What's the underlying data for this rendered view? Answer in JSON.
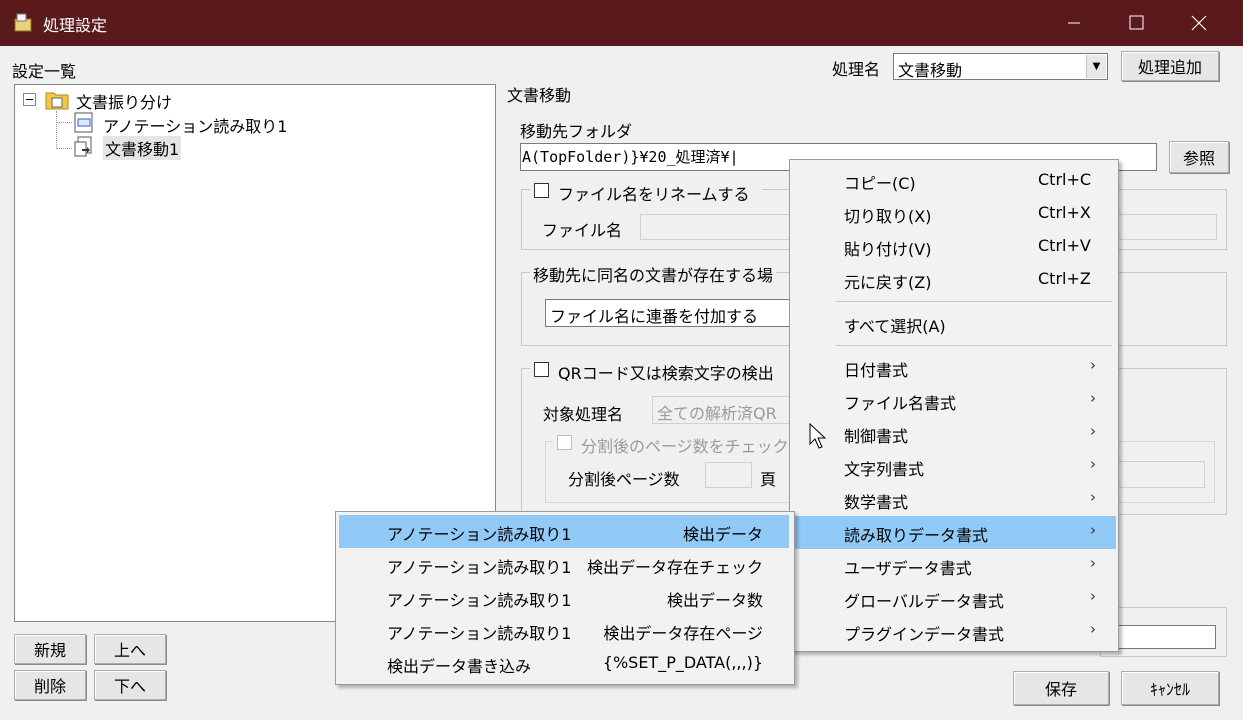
{
  "window": {
    "title": "処理設定",
    "controls": [
      "minimize",
      "maximize",
      "close"
    ]
  },
  "left": {
    "list_title": "設定一覧",
    "tree": [
      {
        "label": "文書振り分け",
        "expander": "minus",
        "icon": "folder-icon"
      },
      {
        "label": "アノテーション読み取り1",
        "icon": "annotation-icon"
      },
      {
        "label": "文書移動1",
        "icon": "document-move-icon"
      }
    ],
    "buttons": {
      "new": "新規",
      "up": "上へ",
      "delete": "削除",
      "down": "下へ"
    }
  },
  "header": {
    "process_name_label": "処理名",
    "process_name_value": "文書移動",
    "add_process": "処理追加"
  },
  "panel": {
    "section_title": "文書移動",
    "dest_folder_label": "移動先フォルダ",
    "dest_folder_value": "A(TopFolder)}¥20_処理済¥|",
    "browse": "参照",
    "rename_checkbox": "ファイル名をリネームする",
    "filename_label": "ファイル名",
    "duplicate_group": "移動先に同名の文書が存在する場",
    "duplicate_value": "ファイル名に連番を付加する",
    "qr_checkbox": "QRコード又は検索文字の検出",
    "target_process_label": "対象処理名",
    "target_process_value": "全ての解析済QR",
    "split_check_label": "分割後のページ数をチェック",
    "split_pages_label": "分割後ページ数",
    "page_unit": "頁"
  },
  "footer": {
    "save": "保存",
    "cancel": "ｷｬﾝｾﾙ"
  },
  "context_menu": {
    "items": [
      {
        "label": "コピー(C)",
        "shortcut": "Ctrl+C"
      },
      {
        "label": "切り取り(X)",
        "shortcut": "Ctrl+X"
      },
      {
        "label": "貼り付け(V)",
        "shortcut": "Ctrl+V"
      },
      {
        "label": "元に戻す(Z)",
        "shortcut": "Ctrl+Z"
      },
      {
        "label": "すべて選択(A)",
        "shortcut": ""
      },
      {
        "label": "日付書式",
        "arrow": "›"
      },
      {
        "label": "ファイル名書式",
        "arrow": "›"
      },
      {
        "label": "制御書式",
        "arrow": "›"
      },
      {
        "label": "文字列書式",
        "arrow": "›"
      },
      {
        "label": "数学書式",
        "arrow": "›"
      },
      {
        "label": "読み取りデータ書式",
        "arrow": "›"
      },
      {
        "label": "ユーザデータ書式",
        "arrow": "›"
      },
      {
        "label": "グローバルデータ書式",
        "arrow": "›"
      },
      {
        "label": "プラグインデータ書式",
        "arrow": "›"
      }
    ],
    "highlighted": "読み取りデータ書式"
  },
  "submenu": {
    "items": [
      {
        "left": "アノテーション読み取り1",
        "right": "検出データ"
      },
      {
        "left": "アノテーション読み取り1",
        "right": "検出データ存在チェック"
      },
      {
        "left": "アノテーション読み取り1",
        "right": "検出データ数"
      },
      {
        "left": "アノテーション読み取り1",
        "right": "検出データ存在ページ"
      },
      {
        "left": "検出データ書き込み",
        "right": "{%SET_P_DATA(,,,)}"
      }
    ],
    "highlighted_index": 0
  },
  "colors": {
    "titlebar": "#5a1a1c",
    "highlight": "#91c9f7"
  }
}
